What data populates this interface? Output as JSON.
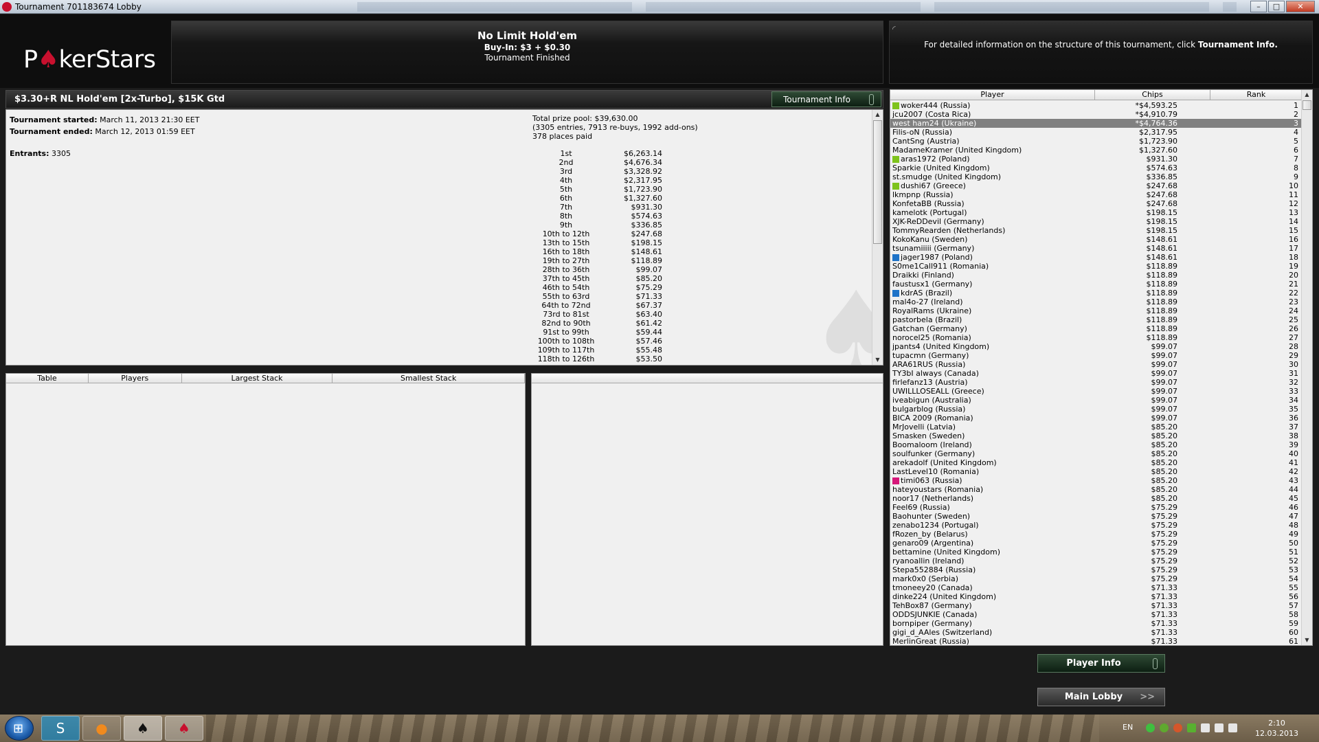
{
  "window": {
    "title": "Tournament 701183674 Lobby",
    "buttons": {
      "minimize": "–",
      "maximize": "□",
      "close": "✕"
    }
  },
  "header": {
    "logo_a": "P",
    "logo_b": "kerStars",
    "game": {
      "title": "No Limit Hold'em",
      "buyin": "Buy-In: $3 + $0.30",
      "status": "Tournament Finished"
    },
    "info_text_prefix": "For detailed information on the structure of this tournament, click ",
    "info_text_link": "Tournament Info."
  },
  "tournament": {
    "name": "$3.30+R NL Hold'em [2x-Turbo], $15K Gtd",
    "info_button": "Tournament Info",
    "started_label": "Tournament started:",
    "started_value": "March 11, 2013 21:30 EET",
    "ended_label": "Tournament ended:",
    "ended_value": "March 12, 2013 01:59 EET",
    "entrants_label": "Entrants:",
    "entrants_value": "3305",
    "prize_pool": "Total prize pool: $39,630.00",
    "entries_line": "(3305 entries, 7913 re-buys, 1992 add-ons)",
    "places_paid": "378 places paid",
    "payouts": [
      {
        "place": "1st",
        "amount": "$6,263.14"
      },
      {
        "place": "2nd",
        "amount": "$4,676.34"
      },
      {
        "place": "3rd",
        "amount": "$3,328.92"
      },
      {
        "place": "4th",
        "amount": "$2,317.95"
      },
      {
        "place": "5th",
        "amount": "$1,723.90"
      },
      {
        "place": "6th",
        "amount": "$1,327.60"
      },
      {
        "place": "7th",
        "amount": "$931.30"
      },
      {
        "place": "8th",
        "amount": "$574.63"
      },
      {
        "place": "9th",
        "amount": "$336.85"
      },
      {
        "place": "10th to 12th",
        "amount": "$247.68"
      },
      {
        "place": "13th to 15th",
        "amount": "$198.15"
      },
      {
        "place": "16th to 18th",
        "amount": "$148.61"
      },
      {
        "place": "19th to 27th",
        "amount": "$118.89"
      },
      {
        "place": "28th to 36th",
        "amount": "$99.07"
      },
      {
        "place": "37th to 45th",
        "amount": "$85.20"
      },
      {
        "place": "46th to 54th",
        "amount": "$75.29"
      },
      {
        "place": "55th to 63rd",
        "amount": "$71.33"
      },
      {
        "place": "64th to 72nd",
        "amount": "$67.37"
      },
      {
        "place": "73rd to 81st",
        "amount": "$63.40"
      },
      {
        "place": "82nd to 90th",
        "amount": "$61.42"
      },
      {
        "place": "91st to 99th",
        "amount": "$59.44"
      },
      {
        "place": "100th to 108th",
        "amount": "$57.46"
      },
      {
        "place": "109th to 117th",
        "amount": "$55.48"
      },
      {
        "place": "118th to 126th",
        "amount": "$53.50"
      }
    ]
  },
  "tables_panel": {
    "columns": [
      "Table",
      "Players",
      "Largest Stack",
      "Smallest Stack"
    ]
  },
  "players_panel": {
    "columns": [
      "Player",
      "Chips",
      "Rank"
    ],
    "rows": [
      {
        "name": "woker444 (Russia)",
        "chips": "*$4,593.25",
        "rank": "1",
        "flag": "#7ec31c"
      },
      {
        "name": "jcu2007 (Costa Rica)",
        "chips": "*$4,910.79",
        "rank": "2",
        "flag": ""
      },
      {
        "name": "west ham24 (Ukraine)",
        "chips": "*$4,764.36",
        "rank": "3",
        "flag": "",
        "selected": true
      },
      {
        "name": "Filis-oN (Russia)",
        "chips": "$2,317.95",
        "rank": "4",
        "flag": ""
      },
      {
        "name": "CantSng (Austria)",
        "chips": "$1,723.90",
        "rank": "5",
        "flag": ""
      },
      {
        "name": "MadameKramer (United Kingdom)",
        "chips": "$1,327.60",
        "rank": "6",
        "flag": ""
      },
      {
        "name": "aras1972 (Poland)",
        "chips": "$931.30",
        "rank": "7",
        "flag": "#7ec31c"
      },
      {
        "name": "Sparkie (United Kingdom)",
        "chips": "$574.63",
        "rank": "8",
        "flag": ""
      },
      {
        "name": "st.smudge (United Kingdom)",
        "chips": "$336.85",
        "rank": "9",
        "flag": ""
      },
      {
        "name": "dushi67 (Greece)",
        "chips": "$247.68",
        "rank": "10",
        "flag": "#7ec31c"
      },
      {
        "name": "lkmpnp (Russia)",
        "chips": "$247.68",
        "rank": "11",
        "flag": ""
      },
      {
        "name": "KonfetaBB (Russia)",
        "chips": "$247.68",
        "rank": "12",
        "flag": ""
      },
      {
        "name": "kamelotk (Portugal)",
        "chips": "$198.15",
        "rank": "13",
        "flag": ""
      },
      {
        "name": "XJK-ReDDevil (Germany)",
        "chips": "$198.15",
        "rank": "14",
        "flag": ""
      },
      {
        "name": "TommyRearden (Netherlands)",
        "chips": "$198.15",
        "rank": "15",
        "flag": ""
      },
      {
        "name": "KokoKanu (Sweden)",
        "chips": "$148.61",
        "rank": "16",
        "flag": ""
      },
      {
        "name": "tsunamiiiii (Germany)",
        "chips": "$148.61",
        "rank": "17",
        "flag": ""
      },
      {
        "name": "jager1987 (Poland)",
        "chips": "$148.61",
        "rank": "18",
        "flag": "#1e73c8"
      },
      {
        "name": "S0me1Call911 (Romania)",
        "chips": "$118.89",
        "rank": "19",
        "flag": ""
      },
      {
        "name": "Draikki (Finland)",
        "chips": "$118.89",
        "rank": "20",
        "flag": ""
      },
      {
        "name": "faustusx1 (Germany)",
        "chips": "$118.89",
        "rank": "21",
        "flag": ""
      },
      {
        "name": "kdrAS (Brazil)",
        "chips": "$118.89",
        "rank": "22",
        "flag": "#1e73c8"
      },
      {
        "name": "mal4o-27 (Ireland)",
        "chips": "$118.89",
        "rank": "23",
        "flag": ""
      },
      {
        "name": "RoyalRams (Ukraine)",
        "chips": "$118.89",
        "rank": "24",
        "flag": ""
      },
      {
        "name": "pastorbela (Brazil)",
        "chips": "$118.89",
        "rank": "25",
        "flag": ""
      },
      {
        "name": "Gatchan (Germany)",
        "chips": "$118.89",
        "rank": "26",
        "flag": ""
      },
      {
        "name": "norocel25 (Romania)",
        "chips": "$118.89",
        "rank": "27",
        "flag": ""
      },
      {
        "name": "jpants4 (United Kingdom)",
        "chips": "$99.07",
        "rank": "28",
        "flag": ""
      },
      {
        "name": "tupacmn (Germany)",
        "chips": "$99.07",
        "rank": "29",
        "flag": ""
      },
      {
        "name": "ARA61RUS (Russia)",
        "chips": "$99.07",
        "rank": "30",
        "flag": ""
      },
      {
        "name": "TY3bI always (Canada)",
        "chips": "$99.07",
        "rank": "31",
        "flag": ""
      },
      {
        "name": "firlefanz13 (Austria)",
        "chips": "$99.07",
        "rank": "32",
        "flag": ""
      },
      {
        "name": "UWILLLOSEALL (Greece)",
        "chips": "$99.07",
        "rank": "33",
        "flag": ""
      },
      {
        "name": "iveabigun (Australia)",
        "chips": "$99.07",
        "rank": "34",
        "flag": ""
      },
      {
        "name": "bulgarblog (Russia)",
        "chips": "$99.07",
        "rank": "35",
        "flag": ""
      },
      {
        "name": "BICA 2009 (Romania)",
        "chips": "$99.07",
        "rank": "36",
        "flag": ""
      },
      {
        "name": "MrJovelli (Latvia)",
        "chips": "$85.20",
        "rank": "37",
        "flag": ""
      },
      {
        "name": "Smasken (Sweden)",
        "chips": "$85.20",
        "rank": "38",
        "flag": ""
      },
      {
        "name": "Boomaloom (Ireland)",
        "chips": "$85.20",
        "rank": "39",
        "flag": ""
      },
      {
        "name": "soulfunker (Germany)",
        "chips": "$85.20",
        "rank": "40",
        "flag": ""
      },
      {
        "name": "arekadolf (United Kingdom)",
        "chips": "$85.20",
        "rank": "41",
        "flag": ""
      },
      {
        "name": "LastLevel10 (Romania)",
        "chips": "$85.20",
        "rank": "42",
        "flag": ""
      },
      {
        "name": "timi063 (Russia)",
        "chips": "$85.20",
        "rank": "43",
        "flag": "#d6177a"
      },
      {
        "name": "hateyoustars (Romania)",
        "chips": "$85.20",
        "rank": "44",
        "flag": ""
      },
      {
        "name": "noor17 (Netherlands)",
        "chips": "$85.20",
        "rank": "45",
        "flag": ""
      },
      {
        "name": "Feel69 (Russia)",
        "chips": "$75.29",
        "rank": "46",
        "flag": ""
      },
      {
        "name": "Baohunter (Sweden)",
        "chips": "$75.29",
        "rank": "47",
        "flag": ""
      },
      {
        "name": "zenabo1234 (Portugal)",
        "chips": "$75.29",
        "rank": "48",
        "flag": ""
      },
      {
        "name": "fRozen_by (Belarus)",
        "chips": "$75.29",
        "rank": "49",
        "flag": ""
      },
      {
        "name": "genaro09 (Argentina)",
        "chips": "$75.29",
        "rank": "50",
        "flag": ""
      },
      {
        "name": "bettamine (United Kingdom)",
        "chips": "$75.29",
        "rank": "51",
        "flag": ""
      },
      {
        "name": "ryanoallin (Ireland)",
        "chips": "$75.29",
        "rank": "52",
        "flag": ""
      },
      {
        "name": "Stepa552884 (Russia)",
        "chips": "$75.29",
        "rank": "53",
        "flag": ""
      },
      {
        "name": "mark0x0 (Serbia)",
        "chips": "$75.29",
        "rank": "54",
        "flag": ""
      },
      {
        "name": "tmoneey20 (Canada)",
        "chips": "$71.33",
        "rank": "55",
        "flag": ""
      },
      {
        "name": "dinke224 (United Kingdom)",
        "chips": "$71.33",
        "rank": "56",
        "flag": ""
      },
      {
        "name": "TehBox87 (Germany)",
        "chips": "$71.33",
        "rank": "57",
        "flag": ""
      },
      {
        "name": "ODDSJUNKIE (Canada)",
        "chips": "$71.33",
        "rank": "58",
        "flag": ""
      },
      {
        "name": "bornpiper (Germany)",
        "chips": "$71.33",
        "rank": "59",
        "flag": ""
      },
      {
        "name": "gigi_d_AAles (Switzerland)",
        "chips": "$71.33",
        "rank": "60",
        "flag": ""
      },
      {
        "name": "MerlinGreat (Russia)",
        "chips": "$71.33",
        "rank": "61",
        "flag": ""
      }
    ]
  },
  "buttons": {
    "player_info": "Player Info",
    "main_lobby": "Main Lobby",
    "main_lobby_chevron": ">>"
  },
  "taskbar": {
    "language": "EN",
    "time": "2:10",
    "date": "12.03.2013"
  }
}
